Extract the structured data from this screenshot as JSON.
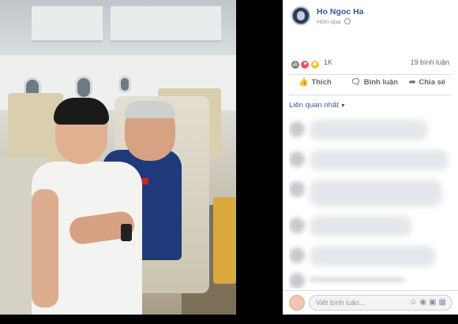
{
  "post": {
    "author": "Ho Ngoc Ha",
    "time": "Hôm qua",
    "privacy_icon": "globe-icon"
  },
  "reactions": {
    "types": [
      "like",
      "love",
      "haha"
    ],
    "count": "1K",
    "comments": "19 bình luận"
  },
  "actions": {
    "like": "Thích",
    "comment": "Bình luận",
    "share": "Chia sẻ"
  },
  "comments": {
    "filter": "Liên quan nhất"
  },
  "composer": {
    "placeholder": "Viết bình luận..."
  },
  "colors": {
    "link": "#385898",
    "muted": "#90949c",
    "action": "#606770"
  }
}
